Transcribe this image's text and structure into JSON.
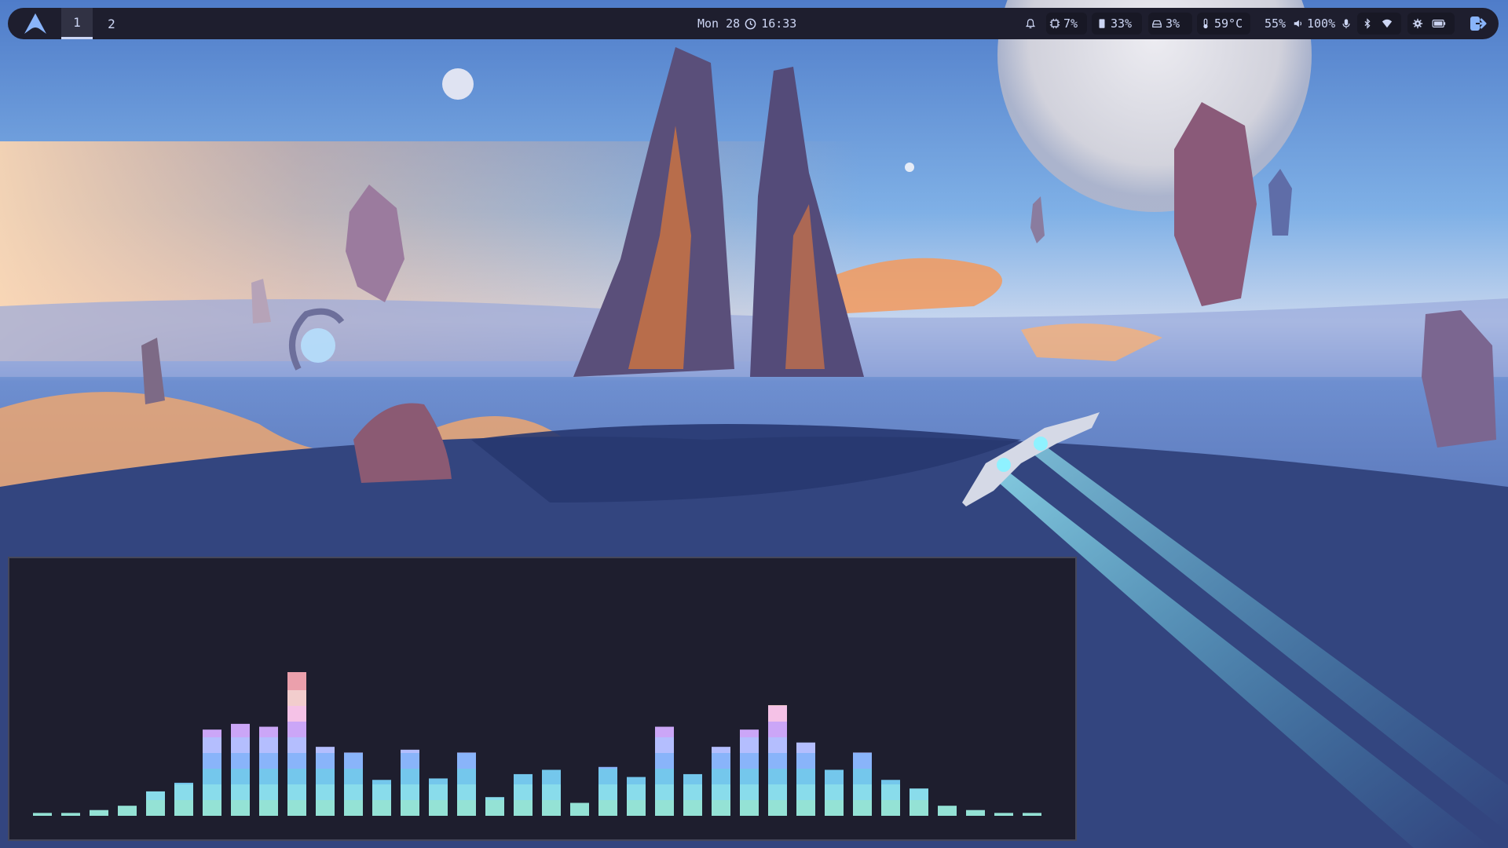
{
  "topbar": {
    "workspaces": [
      {
        "label": "1",
        "active": true
      },
      {
        "label": "2",
        "active": false
      }
    ],
    "clock": {
      "date": "Mon 28",
      "time": "16:33"
    },
    "modules": {
      "notifications_icon": "bell-icon",
      "cpu": {
        "icon": "cpu-icon",
        "value": "7%"
      },
      "memory": {
        "icon": "memory-icon",
        "value": "33%"
      },
      "disk": {
        "icon": "disk-icon",
        "value": "3%"
      },
      "temperature": {
        "icon": "thermometer-icon",
        "value": "59°C"
      },
      "brightness": {
        "value": "55%"
      },
      "volume": {
        "icon": "speaker-icon",
        "value": "100%"
      },
      "mic_icon": "microphone-icon",
      "bluetooth_icon": "bluetooth-icon",
      "wifi_icon": "wifi-icon",
      "settings_icon": "gear-icon",
      "battery_icon": "battery-icon",
      "power_icon": "logout-icon"
    }
  },
  "visualizer": {
    "levels": [
      0.02,
      0.02,
      0.04,
      0.07,
      0.17,
      0.23,
      0.6,
      0.64,
      0.62,
      1.0,
      0.48,
      0.44,
      0.25,
      0.46,
      0.26,
      0.44,
      0.13,
      0.29,
      0.32,
      0.09,
      0.34,
      0.27,
      0.62,
      0.29,
      0.48,
      0.6,
      0.77,
      0.51,
      0.32,
      0.44,
      0.25,
      0.19,
      0.07,
      0.04,
      0.02,
      0.02
    ],
    "colors": [
      "#94e2d5",
      "#89dceb",
      "#74c7ec",
      "#89b4fa",
      "#b4befe",
      "#cba6f7",
      "#f5c2e7",
      "#f2cdcd",
      "#eba0ac"
    ]
  },
  "theme": {
    "bar_bg": "#1e1e2e",
    "text": "#cdd6f4",
    "accent": "#89b4fa"
  }
}
